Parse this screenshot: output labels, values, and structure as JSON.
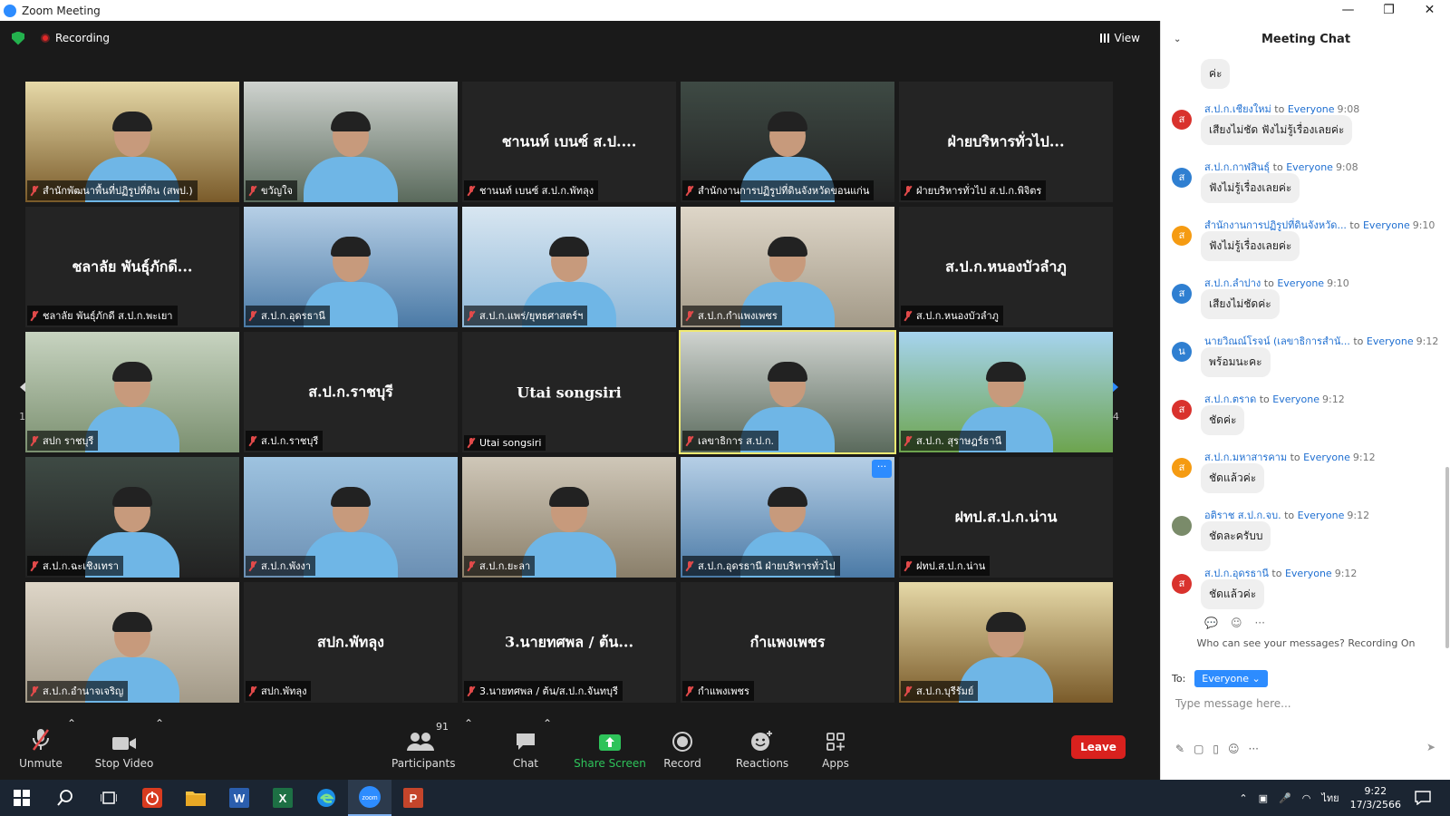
{
  "window": {
    "title": "Zoom Meeting",
    "minimize": "—",
    "restore": "❐",
    "close": "✕"
  },
  "meeting": {
    "recording": "Recording",
    "view": "View"
  },
  "pager": {
    "left": "1/4",
    "right": "1/4"
  },
  "tiles": [
    {
      "label": "สำนักพัฒนาพื้นที่ปฏิรูปที่ดิน (สพป.)",
      "video": true
    },
    {
      "label": "ขวัญใจ",
      "video": true
    },
    {
      "label": "ชานนท์ เบนซ์ ส.ป.ก.พัทลุง",
      "name": "ชานนท์ เบนซ์ ส.ป....",
      "video": false
    },
    {
      "label": "สำนักงานการปฏิรูปที่ดินจังหวัดขอนแก่น",
      "video": true
    },
    {
      "label": "ฝ่ายบริหารทั่วไป ส.ป.ก.พิจิตร",
      "name": "ฝ่ายบริหารทั่วไป...",
      "video": false
    },
    {
      "label": "ชลาลัย  พันธุ์ภักดี ส.ป.ก.พะเยา",
      "name": "ชลาลัย  พันธุ์ภักดี...",
      "video": false
    },
    {
      "label": "ส.ป.ก.อุดรธานี",
      "video": true
    },
    {
      "label": "ส.ป.ก.แพร่/ยุทธศาสตร์ฯ",
      "video": true
    },
    {
      "label": "ส.ป.ก.กำแพงเพชร",
      "video": true
    },
    {
      "label": "ส.ป.ก.หนองบัวลำภู",
      "name": "ส.ป.ก.หนองบัวลำภู",
      "video": false
    },
    {
      "label": "สปก ราชบุรี",
      "video": true
    },
    {
      "label": "ส.ป.ก.ราชบุรี",
      "name": "ส.ป.ก.ราชบุรี",
      "video": false
    },
    {
      "label": "Utai songsiri",
      "name": "Utai songsiri",
      "video": false
    },
    {
      "label": "เลขาธิการ ส.ป.ก.",
      "video": true,
      "active": true
    },
    {
      "label": "ส.ป.ก. สุราษฎร์ธานี",
      "video": true
    },
    {
      "label": "ส.ป.ก.ฉะเชิงเทรา",
      "video": true
    },
    {
      "label": "ส.ป.ก.พังงา",
      "video": true
    },
    {
      "label": "ส.ป.ก.ยะลา",
      "video": true
    },
    {
      "label": "ส.ป.ก.อุดรธานี ฝ่ายบริหารทั่วไป",
      "video": true,
      "more": "···"
    },
    {
      "label": "ฝทป.ส.ป.ก.น่าน",
      "name": "ฝทป.ส.ป.ก.น่าน",
      "video": false
    },
    {
      "label": "ส.ป.ก.อำนาจเจริญ",
      "video": true
    },
    {
      "label": "สปก.พัทลุง",
      "name": "สปก.พัทลุง",
      "video": false
    },
    {
      "label": "3.นายทศพล / ต้น/ส.ป.ก.จันทบุรี",
      "name": "3.นายทศพล / ต้น...",
      "video": false
    },
    {
      "label": "กำแพงเพชร",
      "name": "กำแพงเพชร",
      "video": false
    },
    {
      "label": "ส.ป.ก.บุรีรัมย์",
      "video": true
    }
  ],
  "toolbar": {
    "unmute": "Unmute",
    "stop_video": "Stop Video",
    "participants": "Participants",
    "participants_count": "91",
    "chat": "Chat",
    "share": "Share Screen",
    "record": "Record",
    "reactions": "Reactions",
    "apps": "Apps",
    "leave": "Leave"
  },
  "chat": {
    "title": "Meeting Chat",
    "to_word": "to",
    "partial_text": "ค่ะ",
    "messages": [
      {
        "sender": "ส.ป.ก.เชียงใหม่",
        "to": "Everyone",
        "time": "9:08",
        "text": "เสียงไม่ชัด ฟังไม่รู้เรื่องเลยค่ะ",
        "initial": "ส",
        "color": "#d9322d"
      },
      {
        "sender": "ส.ป.ก.กาฬสินธุ์",
        "to": "Everyone",
        "time": "9:08",
        "text": "ฟังไม่รู้เรื่องเลยค่ะ",
        "initial": "ส",
        "color": "#2f7fd1"
      },
      {
        "sender": "สำนักงานการปฏิรูปที่ดินจังหวัด...",
        "to": "Everyone",
        "time": "9:10",
        "text": "ฟังไม่รู้เรื่องเลยค่ะ",
        "initial": "ส",
        "color": "#f59b12"
      },
      {
        "sender": "ส.ป.ก.ลำปาง",
        "to": "Everyone",
        "time": "9:10",
        "text": "เสียงไม่ชัดค่ะ",
        "initial": "ส",
        "color": "#2f7fd1"
      },
      {
        "sender": "นายวิณณ์โรจน์ (เลขาธิการสำนั...",
        "to": "Everyone",
        "time": "9:12",
        "text": "พร้อมนะคะ",
        "initial": "น",
        "color": "#2f7fd1"
      },
      {
        "sender": "ส.ป.ก.ตราด",
        "to": "Everyone",
        "time": "9:12",
        "text": "ชัดค่ะ",
        "initial": "ส",
        "color": "#d9322d"
      },
      {
        "sender": "ส.ป.ก.มหาสารคาม",
        "to": "Everyone",
        "time": "9:12",
        "text": "ชัดแล้วค่ะ",
        "initial": "ส",
        "color": "#f59b12"
      },
      {
        "sender": "อติราช ส.ป.ก.จบ.",
        "to": "Everyone",
        "time": "9:12",
        "text": "ชัดละครับบ",
        "initial": "",
        "color": "#7a8b6a"
      },
      {
        "sender": "ส.ป.ก.อุดรธานี",
        "to": "Everyone",
        "time": "9:12",
        "text": "ชัดแล้วค่ะ",
        "initial": "ส",
        "color": "#d9322d"
      }
    ],
    "who_can_see": "Who can see your messages? Recording On",
    "to_label": "To:",
    "recipient": "Everyone",
    "placeholder": "Type message here..."
  },
  "taskbar": {
    "lang": "ไทย",
    "time": "9:22",
    "date": "17/3/2566",
    "zoom_label": "zoom"
  }
}
